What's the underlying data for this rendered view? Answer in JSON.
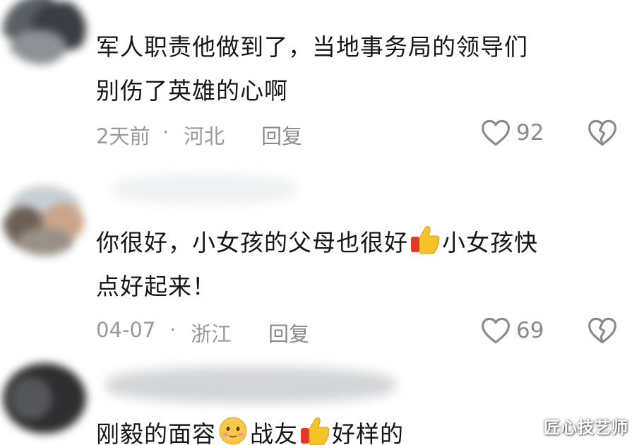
{
  "comments": [
    {
      "text_lines": [
        "军人职责他做到了，当地事务局的领导们",
        "别伤了英雄的心啊"
      ],
      "date": "2天前",
      "separator": "·",
      "region": "河北",
      "reply_label": "回复",
      "likes": "92"
    },
    {
      "text_lines": [
        "你很好，小女孩的父母也很好",
        "小女孩快",
        "点好起来！"
      ],
      "date": "04-07",
      "separator": "·",
      "region": "浙江",
      "reply_label": "回复",
      "likes": "69"
    },
    {
      "text_parts": [
        "刚毅的面容",
        "战友",
        "好样的"
      ]
    }
  ],
  "watermark": "匠心技艺师",
  "icons": {
    "like": "heart-outline-icon",
    "dislike": "broken-heart-icon",
    "thumbs_up": "thumbs-up-emoji",
    "face": "blush-face-emoji"
  },
  "colors": {
    "text": "#161616",
    "meta": "#9a9a9a",
    "icon": "#8a8a8a"
  }
}
